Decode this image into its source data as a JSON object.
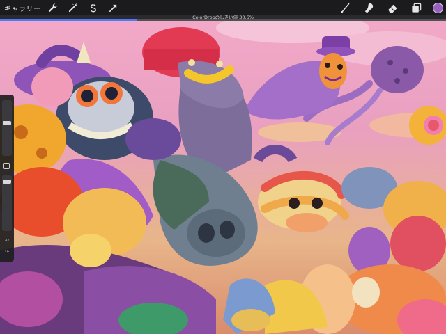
{
  "toolbar": {
    "gallery_label": "ギャラリー",
    "left_tools": [
      "wrench-icon",
      "adjust-wand-icon",
      "selection-s-icon",
      "transform-arrow-icon"
    ],
    "right_tools": [
      "brush-icon",
      "smudge-icon",
      "eraser-icon",
      "layers-icon"
    ],
    "current_color": "#9a5fc2"
  },
  "status": {
    "text": "ColorDropのしきい値 30.6%",
    "threshold_fraction": 0.306
  },
  "colors": {
    "accent": "#4a78ff",
    "toolbar_bg": "#1b1b1d"
  }
}
